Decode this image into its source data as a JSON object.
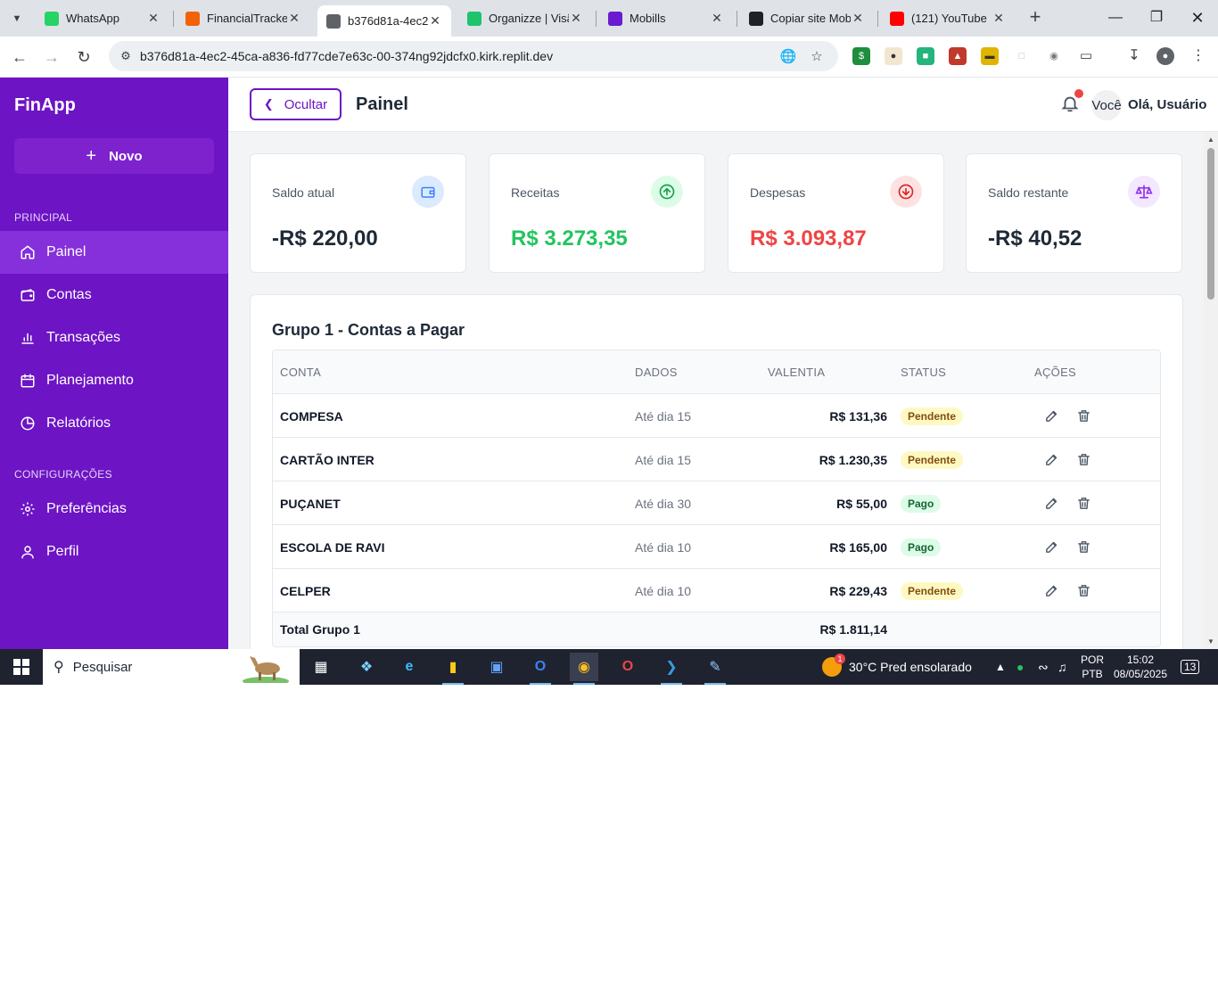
{
  "browser": {
    "tabs": [
      {
        "title": "WhatsApp",
        "icon": "whatsapp-icon",
        "color": "#25d366"
      },
      {
        "title": "FinancialTracker",
        "icon": "replit-icon",
        "color": "#f26207"
      },
      {
        "title": "b376d81a-4ec2-",
        "icon": "globe-icon",
        "color": "#5f6368"
      },
      {
        "title": "Organizze | Visã",
        "icon": "organizze-icon",
        "color": "#1ec36b"
      },
      {
        "title": "Mobills",
        "icon": "mobills-icon",
        "color": "#6a1bd1"
      },
      {
        "title": "Copiar site Mob",
        "icon": "openai-icon",
        "color": "#202124"
      },
      {
        "title": "(121) YouTube",
        "icon": "youtube-icon",
        "color": "#ff0000"
      }
    ],
    "url": "b376d81a-4ec2-45ca-a836-fd77cde7e63c-00-374ng92jdcfx0.kirk.replit.dev"
  },
  "app": {
    "brand": "FinApp",
    "new_button": "Novo",
    "sections": {
      "principal": "PRINCIPAL",
      "config": "CONFIGURAÇÕES"
    },
    "nav": [
      {
        "label": "Painel",
        "icon": "home-icon"
      },
      {
        "label": "Contas",
        "icon": "wallet-icon"
      },
      {
        "label": "Transações",
        "icon": "bar-chart-icon"
      },
      {
        "label": "Planejamento",
        "icon": "calendar-icon"
      },
      {
        "label": "Relatórios",
        "icon": "pie-chart-icon"
      },
      {
        "label": "Preferências",
        "icon": "gear-icon"
      },
      {
        "label": "Perfil",
        "icon": "user-icon"
      }
    ],
    "accent": "#6d14c4"
  },
  "header": {
    "hide_button": "Ocultar",
    "title": "Painel",
    "avatar_text": "Você",
    "greeting": "Olá, Usuário"
  },
  "cards": [
    {
      "label": "Saldo atual",
      "value": "-R$ 220,00",
      "color": "#1f2937",
      "icon": "wallet-icon"
    },
    {
      "label": "Receitas",
      "value": "R$ 3.273,35",
      "color": "#22c55e",
      "icon": "arrow-up-circle-icon"
    },
    {
      "label": "Despesas",
      "value": "R$ 3.093,87",
      "color": "#ef4444",
      "icon": "arrow-down-circle-icon"
    },
    {
      "label": "Saldo restante",
      "value": "-R$ 40,52",
      "color": "#1f2937",
      "icon": "scale-icon"
    }
  ],
  "group": {
    "title": "Grupo 1 - Contas a Pagar",
    "columns": [
      "CONTA",
      "DADOS",
      "VALENTIA",
      "STATUS",
      "AÇÕES"
    ],
    "rows": [
      {
        "conta": "COMPESA",
        "dados": "Até dia 15",
        "valor": "R$ 131,36",
        "status": "Pendente"
      },
      {
        "conta": "CARTÃO INTER",
        "dados": "Até dia 15",
        "valor": "R$ 1.230,35",
        "status": "Pendente"
      },
      {
        "conta": "PUÇANET",
        "dados": "Até dia 30",
        "valor": "R$ 55,00",
        "status": "Pago"
      },
      {
        "conta": "ESCOLA DE RAVI",
        "dados": "Até dia 10",
        "valor": "R$ 165,00",
        "status": "Pago"
      },
      {
        "conta": "CELPER",
        "dados": "Até dia 10",
        "valor": "R$ 229,43",
        "status": "Pendente"
      }
    ],
    "total_label": "Total Grupo 1",
    "total_value": "R$ 1.811,14"
  },
  "taskbar": {
    "search": "Pesquisar",
    "weather": "30°C  Pred ensolarado",
    "weather_badge": "1",
    "lang1": "POR",
    "lang2": "PTB",
    "time": "15:02",
    "date": "08/05/2025",
    "notif": "13"
  }
}
